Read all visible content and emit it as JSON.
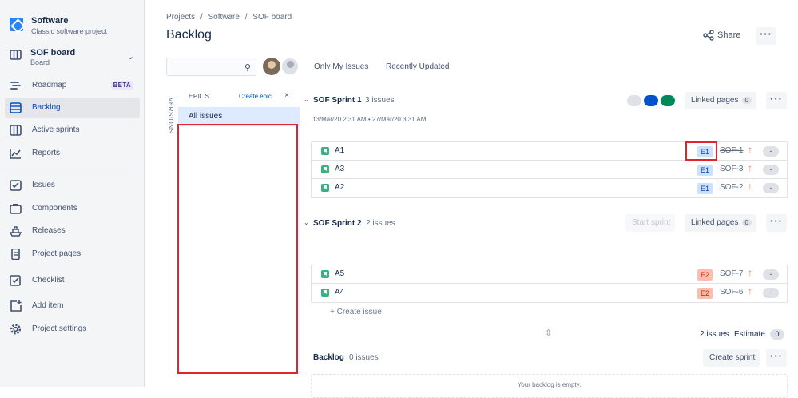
{
  "project": {
    "name": "Software",
    "type": "Classic software project"
  },
  "board": {
    "name": "SOF board",
    "sub": "Board"
  },
  "nav": {
    "roadmap": "Roadmap",
    "beta": "BETA",
    "backlog": "Backlog",
    "active_sprints": "Active sprints",
    "reports": "Reports",
    "issues": "Issues",
    "components": "Components",
    "releases": "Releases",
    "project_pages": "Project pages",
    "checklist": "Checklist",
    "add_item": "Add item",
    "project_settings": "Project settings"
  },
  "breadcrumbs": [
    "Projects",
    "/",
    "Software",
    "/",
    "SOF board"
  ],
  "page_title": "Backlog",
  "share_label": "Share",
  "more_label": "···",
  "search": {
    "placeholder": "",
    "value": ""
  },
  "filters": {
    "only_my_issues": "Only My Issues",
    "recently_updated": "Recently Updated"
  },
  "versions_label": "VERSIONS",
  "epics": {
    "title": "EPICS",
    "create": "Create epic",
    "close": "×",
    "all_issues": "All issues"
  },
  "sprint1": {
    "name": "SOF Sprint 1",
    "count": "3 issues",
    "dates": "13/Mar/20 2:31 AM • 27/Mar/20 3:31 AM",
    "linked_pages": "Linked pages",
    "linked_count": "0",
    "status_colors": [
      "#dfe1e6",
      "#0052cc",
      "#00875a"
    ],
    "issues": [
      {
        "summary": "A1",
        "epic": "E1",
        "key": "SOF-1",
        "done": true,
        "estimate": "-"
      },
      {
        "summary": "A3",
        "epic": "E1",
        "key": "SOF-3",
        "done": false,
        "estimate": "-"
      },
      {
        "summary": "A2",
        "epic": "E1",
        "key": "SOF-2",
        "done": false,
        "estimate": "-"
      }
    ]
  },
  "sprint2": {
    "name": "SOF Sprint 2",
    "count": "2 issues",
    "start_sprint": "Start sprint",
    "linked_pages": "Linked pages",
    "linked_count": "0",
    "issues": [
      {
        "summary": "A5",
        "epic": "E2",
        "key": "SOF-7",
        "estimate": "-"
      },
      {
        "summary": "A4",
        "epic": "E2",
        "key": "SOF-6",
        "estimate": "-"
      }
    ],
    "create_issue": "+  Create issue",
    "footer_count": "2 issues",
    "footer_estimate": "Estimate",
    "footer_estimate_value": "0"
  },
  "backlog": {
    "name": "Backlog",
    "count": "0 issues",
    "create_sprint": "Create sprint",
    "empty": "Your backlog is empty."
  },
  "colors": {
    "e1_bg": "#cce0ff",
    "e1_fg": "#0747a6",
    "e2_bg": "#ffbdad",
    "e2_fg": "#bf2600",
    "highlight": "#e5232e"
  }
}
